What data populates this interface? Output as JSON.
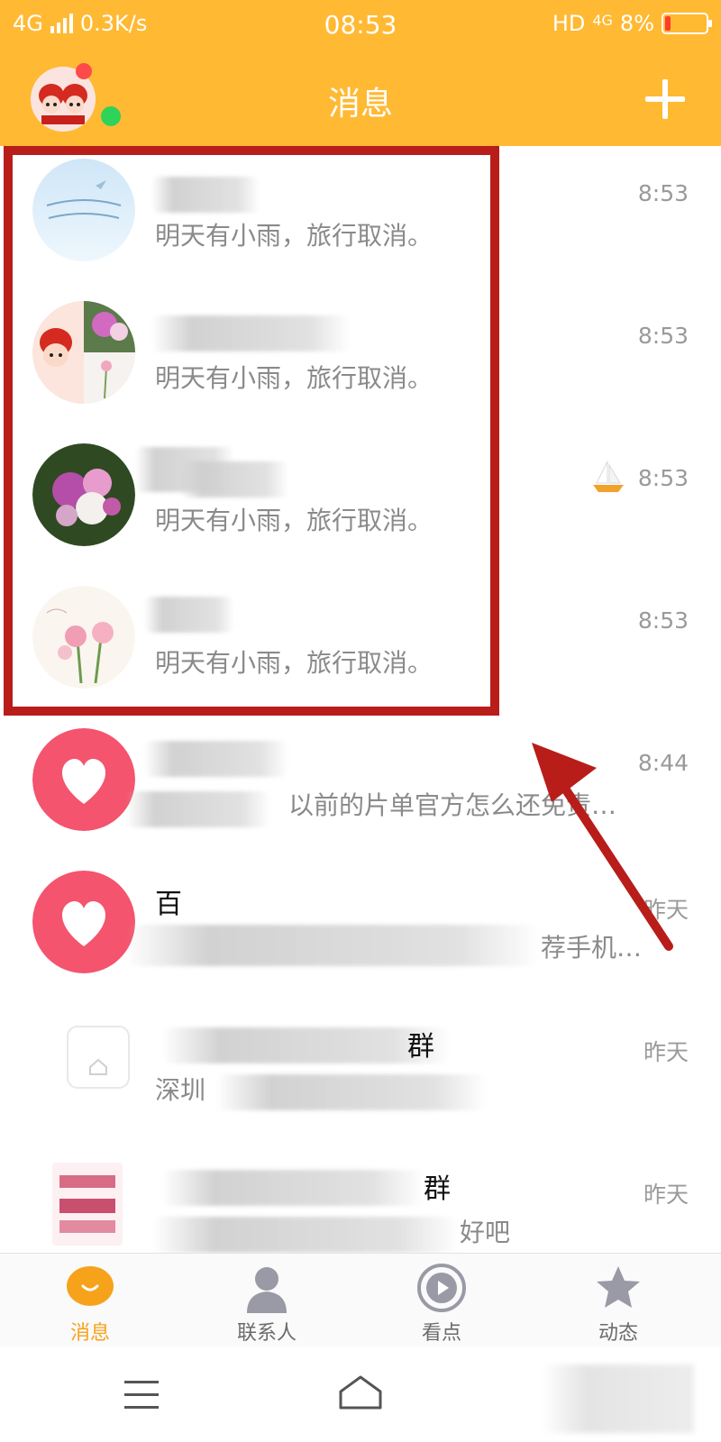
{
  "status": {
    "network": "4G",
    "speed": "0.3K/s",
    "time": "08:53",
    "hd": "HD",
    "network_right": "4G",
    "battery": "8%"
  },
  "header": {
    "title": "消息"
  },
  "chats": [
    {
      "name": "",
      "preview": "明天有小雨，旅行取消。",
      "time": "8:53"
    },
    {
      "name": "",
      "preview": "明天有小雨，旅行取消。",
      "time": "8:53"
    },
    {
      "name": "",
      "preview": "明天有小雨，旅行取消。",
      "time": "8:53",
      "icon": "sailboat-icon"
    },
    {
      "name": "",
      "preview": "明天有小雨，旅行取消。",
      "time": "8:53"
    },
    {
      "name": "",
      "preview": "以前的片单官方怎么还免责…",
      "time": "8:44"
    },
    {
      "name": "百",
      "preview": "荐手机…",
      "time": "昨天"
    },
    {
      "name": "群",
      "preview": "深圳",
      "time": "昨天"
    },
    {
      "name": "群",
      "preview": "好吧",
      "time": "昨天"
    }
  ],
  "tabs": [
    {
      "label": "消息",
      "icon": "message-bubble-icon",
      "active": true
    },
    {
      "label": "联系人",
      "icon": "contact-person-icon",
      "active": false
    },
    {
      "label": "看点",
      "icon": "play-circle-icon",
      "active": false
    },
    {
      "label": "动态",
      "icon": "star-icon",
      "active": false
    }
  ],
  "colors": {
    "accent": "#ffb933",
    "highlight": "#b81d1a",
    "active_tab": "#f7a21b"
  }
}
